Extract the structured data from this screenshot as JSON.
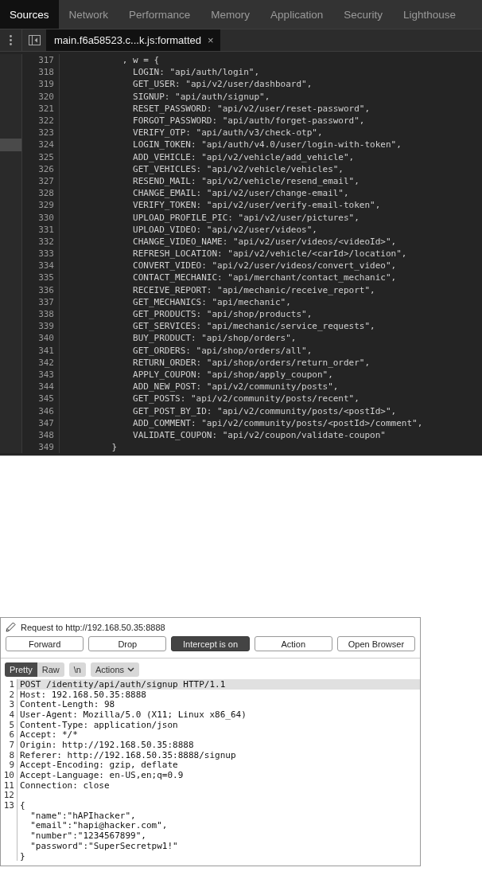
{
  "devtools": {
    "tabs": [
      {
        "label": "Sources",
        "selected": true
      },
      {
        "label": "Network",
        "selected": false
      },
      {
        "label": "Performance",
        "selected": false
      },
      {
        "label": "Memory",
        "selected": false
      },
      {
        "label": "Application",
        "selected": false
      },
      {
        "label": "Security",
        "selected": false
      },
      {
        "label": "Lighthouse",
        "selected": false
      }
    ],
    "file_tab": {
      "label": "main.f6a58523.c...k.js:formatted",
      "close": "×"
    },
    "code_lines": [
      {
        "number": "317",
        "text": "           , w = {",
        "marked": false
      },
      {
        "number": "318",
        "text": "             LOGIN: \"api/auth/login\",",
        "marked": false
      },
      {
        "number": "319",
        "text": "             GET_USER: \"api/v2/user/dashboard\",",
        "marked": false
      },
      {
        "number": "320",
        "text": "             SIGNUP: \"api/auth/signup\",",
        "marked": false
      },
      {
        "number": "321",
        "text": "             RESET_PASSWORD: \"api/v2/user/reset-password\",",
        "marked": false
      },
      {
        "number": "322",
        "text": "             FORGOT_PASSWORD: \"api/auth/forget-password\",",
        "marked": false
      },
      {
        "number": "323",
        "text": "             VERIFY_OTP: \"api/auth/v3/check-otp\",",
        "marked": false
      },
      {
        "number": "324",
        "text": "             LOGIN_TOKEN: \"api/auth/v4.0/user/login-with-token\",",
        "marked": true
      },
      {
        "number": "325",
        "text": "             ADD_VEHICLE: \"api/v2/vehicle/add_vehicle\",",
        "marked": false
      },
      {
        "number": "326",
        "text": "             GET_VEHICLES: \"api/v2/vehicle/vehicles\",",
        "marked": false
      },
      {
        "number": "327",
        "text": "             RESEND_MAIL: \"api/v2/vehicle/resend_email\",",
        "marked": false
      },
      {
        "number": "328",
        "text": "             CHANGE_EMAIL: \"api/v2/user/change-email\",",
        "marked": false
      },
      {
        "number": "329",
        "text": "             VERIFY_TOKEN: \"api/v2/user/verify-email-token\",",
        "marked": false
      },
      {
        "number": "330",
        "text": "             UPLOAD_PROFILE_PIC: \"api/v2/user/pictures\",",
        "marked": false
      },
      {
        "number": "331",
        "text": "             UPLOAD_VIDEO: \"api/v2/user/videos\",",
        "marked": false
      },
      {
        "number": "332",
        "text": "             CHANGE_VIDEO_NAME: \"api/v2/user/videos/<videoId>\",",
        "marked": false
      },
      {
        "number": "333",
        "text": "             REFRESH_LOCATION: \"api/v2/vehicle/<carId>/location\",",
        "marked": false
      },
      {
        "number": "334",
        "text": "             CONVERT_VIDEO: \"api/v2/user/videos/convert_video\",",
        "marked": false
      },
      {
        "number": "335",
        "text": "             CONTACT_MECHANIC: \"api/merchant/contact_mechanic\",",
        "marked": false
      },
      {
        "number": "336",
        "text": "             RECEIVE_REPORT: \"api/mechanic/receive_report\",",
        "marked": false
      },
      {
        "number": "337",
        "text": "             GET_MECHANICS: \"api/mechanic\",",
        "marked": false
      },
      {
        "number": "338",
        "text": "             GET_PRODUCTS: \"api/shop/products\",",
        "marked": false
      },
      {
        "number": "339",
        "text": "             GET_SERVICES: \"api/mechanic/service_requests\",",
        "marked": false
      },
      {
        "number": "340",
        "text": "             BUY_PRODUCT: \"api/shop/orders\",",
        "marked": false
      },
      {
        "number": "341",
        "text": "             GET_ORDERS: \"api/shop/orders/all\",",
        "marked": false
      },
      {
        "number": "342",
        "text": "             RETURN_ORDER: \"api/shop/orders/return_order\",",
        "marked": false
      },
      {
        "number": "343",
        "text": "             APPLY_COUPON: \"api/shop/apply_coupon\",",
        "marked": false
      },
      {
        "number": "344",
        "text": "             ADD_NEW_POST: \"api/v2/community/posts\",",
        "marked": false
      },
      {
        "number": "345",
        "text": "             GET_POSTS: \"api/v2/community/posts/recent\",",
        "marked": false
      },
      {
        "number": "346",
        "text": "             GET_POST_BY_ID: \"api/v2/community/posts/<postId>\",",
        "marked": false
      },
      {
        "number": "347",
        "text": "             ADD_COMMENT: \"api/v2/community/posts/<postId>/comment\",",
        "marked": false
      },
      {
        "number": "348",
        "text": "             VALIDATE_COUPON: \"api/v2/coupon/validate-coupon\"",
        "marked": false
      },
      {
        "number": "349",
        "text": "         }",
        "marked": false
      }
    ]
  },
  "intercept": {
    "title": "Request to http://192.168.50.35:8888",
    "buttons": [
      {
        "label": "Forward",
        "selected": false
      },
      {
        "label": "Drop",
        "selected": false
      },
      {
        "label": "Intercept is on",
        "selected": true
      },
      {
        "label": "Action",
        "selected": false
      },
      {
        "label": "Open Browser",
        "selected": false
      }
    ],
    "view_tabs": [
      {
        "label": "Pretty",
        "selected": true
      },
      {
        "label": "Raw",
        "selected": false
      }
    ],
    "newline_toggle": "\\n",
    "actions_menu": "Actions",
    "request_lines": [
      {
        "number": "1",
        "text": "POST /identity/api/auth/signup HTTP/1.1",
        "highlighted": true
      },
      {
        "number": "2",
        "text": "Host: 192.168.50.35:8888",
        "highlighted": false
      },
      {
        "number": "3",
        "text": "Content-Length: 98",
        "highlighted": false
      },
      {
        "number": "4",
        "text": "User-Agent: Mozilla/5.0 (X11; Linux x86_64)",
        "highlighted": false
      },
      {
        "number": "5",
        "text": "Content-Type: application/json",
        "highlighted": false
      },
      {
        "number": "6",
        "text": "Accept: */*",
        "highlighted": false
      },
      {
        "number": "7",
        "text": "Origin: http://192.168.50.35:8888",
        "highlighted": false
      },
      {
        "number": "8",
        "text": "Referer: http://192.168.50.35:8888/signup",
        "highlighted": false
      },
      {
        "number": "9",
        "text": "Accept-Encoding: gzip, deflate",
        "highlighted": false
      },
      {
        "number": "10",
        "text": "Accept-Language: en-US,en;q=0.9",
        "highlighted": false
      },
      {
        "number": "11",
        "text": "Connection: close",
        "highlighted": false
      },
      {
        "number": "12",
        "highlighted": false
      },
      {
        "number": "13",
        "text": "{",
        "highlighted": false
      },
      {
        "text": "  \"name\":\"hAPIhacker\",",
        "highlighted": false
      },
      {
        "text": "  \"email\":\"hapi@hacker.com\",",
        "highlighted": false
      },
      {
        "text": "  \"number\":\"1234567899\",",
        "highlighted": false
      },
      {
        "text": "  \"password\":\"SuperSecretpw1!\"",
        "highlighted": false
      },
      {
        "text": "}",
        "highlighted": false
      }
    ]
  }
}
